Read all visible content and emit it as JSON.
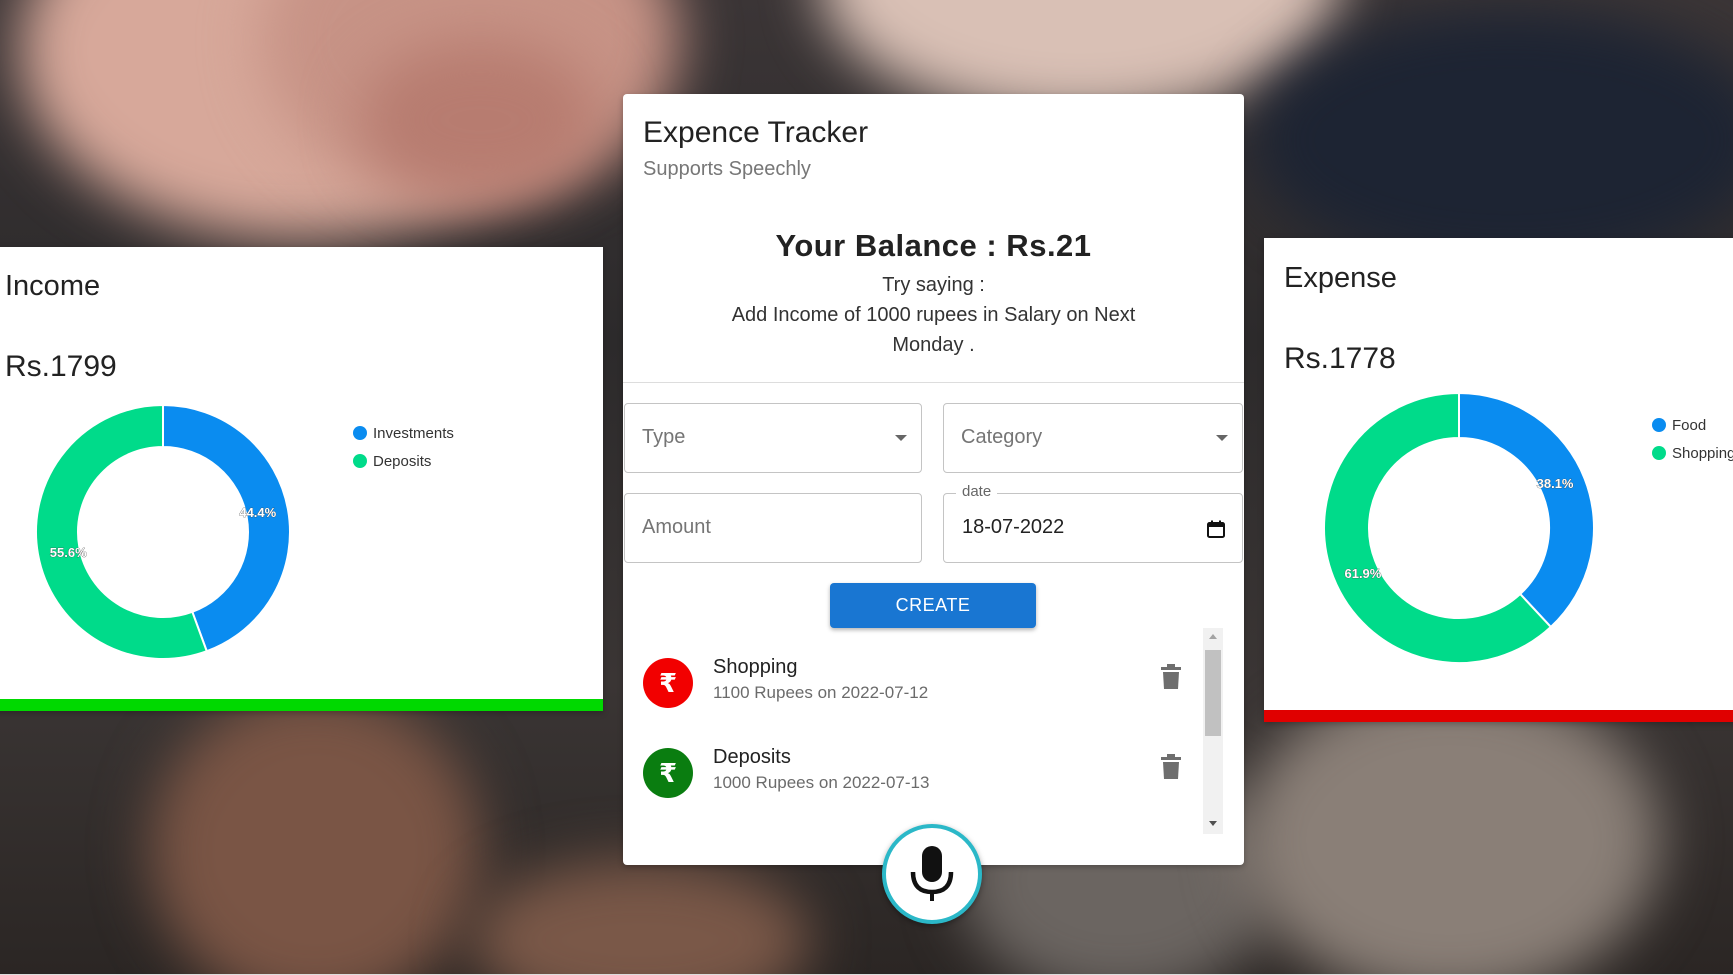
{
  "app": {
    "title": "Expence Tracker",
    "subtitle": "Supports Speechly",
    "balance": "Your Balance : Rs.21",
    "hint_line1": "Try saying :",
    "hint_line2": "Add Income of 1000 rupees in Salary on Next Monday ."
  },
  "form": {
    "type_placeholder": "Type",
    "category_placeholder": "Category",
    "amount_placeholder": "Amount",
    "date_label": "date",
    "date_value": "18-07-2022",
    "create_label": "CREATE"
  },
  "transactions": [
    {
      "name": "Shopping",
      "detail": "1100 Rupees on 2022-07-12",
      "type": "expense",
      "symbol": "₹",
      "color": "#f20000"
    },
    {
      "name": "Deposits",
      "detail": "1000 Rupees on 2022-07-13",
      "type": "income",
      "symbol": "₹",
      "color": "#0a7d10"
    }
  ],
  "income": {
    "title": "Income",
    "amount": "Rs.1799",
    "accent": "#00d900",
    "chart_data": {
      "type": "pie",
      "categories": [
        "Investments",
        "Deposits"
      ],
      "values": [
        44.4,
        55.6
      ],
      "labels": [
        "44.4%",
        "55.6%"
      ],
      "colors": [
        "#0a8cf0",
        "#00db8a"
      ],
      "legend": "top-right"
    }
  },
  "expense": {
    "title": "Expense",
    "amount": "Rs.1778",
    "accent": "#e00000",
    "chart_data": {
      "type": "pie",
      "categories": [
        "Food",
        "Shopping"
      ],
      "values": [
        38.1,
        61.9
      ],
      "labels": [
        "38.1%",
        "61.9%"
      ],
      "colors": [
        "#0a8cf0",
        "#00db8a"
      ],
      "legend": "top-right"
    }
  },
  "icons": {
    "mic": "microphone-icon",
    "delete": "trash-icon",
    "calendar": "calendar-icon",
    "dropdown": "chevron-down-icon"
  }
}
